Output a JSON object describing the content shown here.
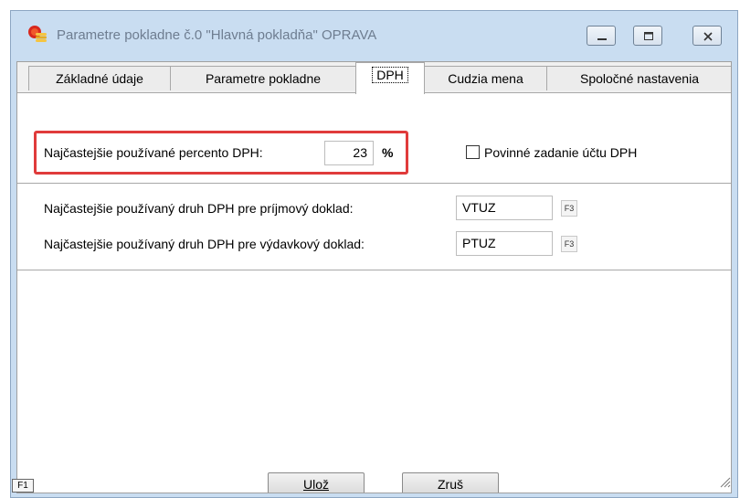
{
  "window": {
    "title": "Parametre pokladne č.0 \"Hlavná pokladňa\" OPRAVA",
    "controls": [
      "minimize-icon",
      "maximize-icon",
      "close-icon"
    ]
  },
  "tabs": [
    {
      "label": "Základné údaje",
      "active": false
    },
    {
      "label": "Parametre pokladne",
      "active": false
    },
    {
      "label": "DPH",
      "active": true
    },
    {
      "label": "Cudzia mena",
      "active": false
    },
    {
      "label": "Spoločné nastavenia",
      "active": false
    }
  ],
  "vat_section": {
    "percent_label": "Najčastejšie používané percento DPH:",
    "percent_value": "23",
    "percent_unit": "%",
    "checkbox_label": "Povinné zadanie účtu DPH",
    "checkbox_checked": false,
    "highlight_color": "#e03b3b"
  },
  "vat_types": {
    "income_label": "Najčastejšie používaný druh DPH pre príjmový doklad:",
    "income_value": "VTUZ",
    "expense_label": "Najčastejšie používaný druh DPH pre výdavkový doklad:",
    "expense_value": "PTUZ",
    "lookup_label": "F3"
  },
  "footer": {
    "help_key": "F1",
    "save_label": "Ulož",
    "cancel_label": "Zruš"
  }
}
